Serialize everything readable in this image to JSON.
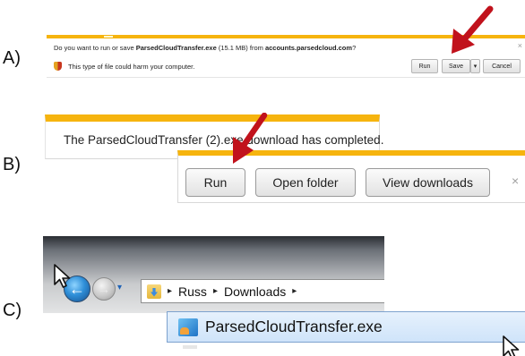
{
  "steps": [
    "A)",
    "B)",
    "C)"
  ],
  "colors": {
    "notification_bar": "#f6b40e",
    "arrow": "#c1121c"
  },
  "download_bar": {
    "question_prefix": "Do you want to run or save ",
    "file": "ParsedCloudTransfer.exe",
    "size_text": " (15.1 MB) from ",
    "domain": "accounts.parsedcloud.com",
    "question_end": "?",
    "warning": "This type of file could harm your computer.",
    "run_label": "Run",
    "save_label": "Save",
    "save_options_glyph": "▾",
    "cancel_label": "Cancel",
    "close_glyph": "×"
  },
  "complete_bar": {
    "message": "The ParsedCloudTransfer (2).exe download has completed.",
    "run_label": "Run",
    "open_folder_label": "Open folder",
    "view_downloads_label": "View downloads",
    "close_glyph": "×"
  },
  "explorer": {
    "back_glyph": "←",
    "forward_glyph": "→",
    "dropdown_glyph": "▾",
    "separator": "▸",
    "breadcrumbs": [
      "Russ",
      "Downloads"
    ],
    "file_name": "ParsedCloudTransfer.exe"
  }
}
